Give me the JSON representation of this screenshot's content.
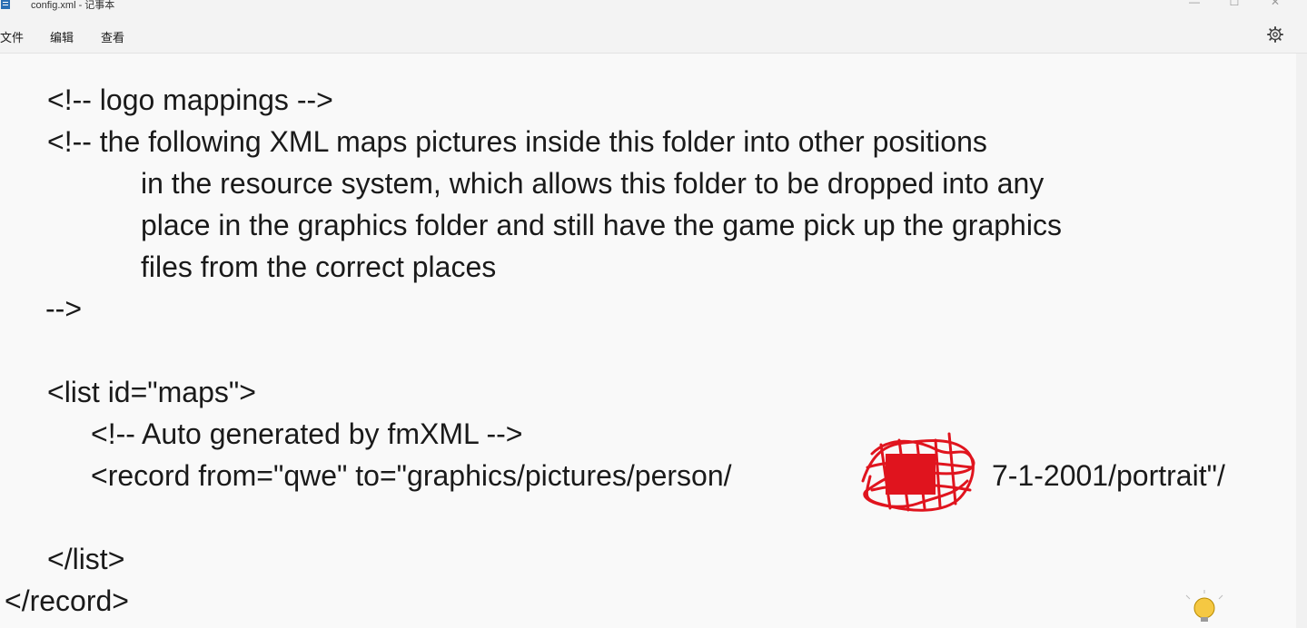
{
  "window": {
    "title": "config.xml - 记事本",
    "controls": {
      "minimize": "—",
      "maximize": "☐",
      "close": "✕"
    }
  },
  "menu": {
    "file": "文件",
    "edit": "编辑",
    "view": "查看"
  },
  "icons": {
    "settings": "gear-icon",
    "app": "notepad-icon",
    "tray": "light-bulb-icon"
  },
  "editor": {
    "lines": [
      "<!-- logo mappings -->",
      "<!-- the following XML maps pictures inside this folder into other positions",
      "in the resource system, which allows this folder to be dropped into any",
      "place in the graphics folder and still have the game pick up the graphics",
      "files from the correct places",
      "-->",
      "<list id=\"maps\">",
      "<!-- Auto generated by fmXML -->",
      "<record from=\"qwe\" to=\"graphics/pictures/person/",
      "7-1-2001/portrait\"/",
      "</list>",
      "</record>"
    ]
  },
  "colors": {
    "scribble": "#e0141e",
    "background": "#f9f9f9",
    "text": "#1a1a1a"
  }
}
